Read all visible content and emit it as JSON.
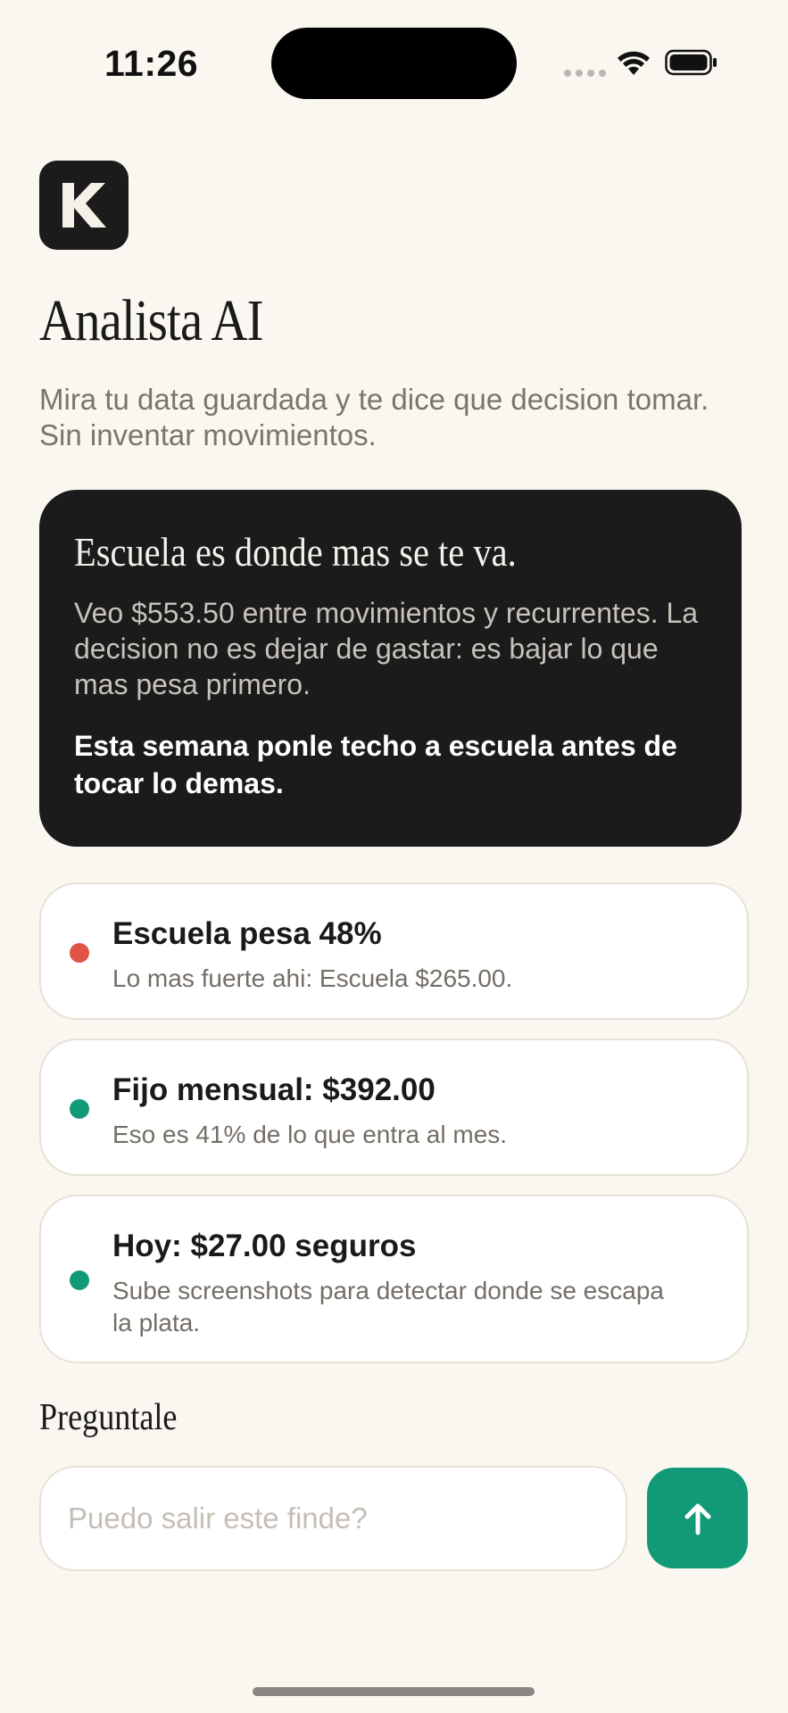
{
  "status_bar": {
    "time": "11:26"
  },
  "app": {
    "logo_letter": "K",
    "title": "Analista AI",
    "subtitle": "Mira tu data guardada y te dice que decision tomar. Sin inventar movimientos."
  },
  "insight": {
    "title": "Escuela es donde mas se te va.",
    "body": "Veo $553.50 entre movimientos y recurrentes. La decision no es dejar de gastar: es bajar lo que mas pesa primero.",
    "action": "Esta semana ponle techo a escuela antes de tocar lo demas."
  },
  "stats": [
    {
      "title": "Escuela pesa 48%",
      "subtitle": "Lo mas fuerte ahi: Escuela $265.00.",
      "dot_color": "#e05448"
    },
    {
      "title": "Fijo mensual: $392.00",
      "subtitle": "Eso es 41% de lo que entra al mes.",
      "dot_color": "#129a78"
    },
    {
      "title": "Hoy: $27.00 seguros",
      "subtitle": "Sube screenshots para detectar donde se escapa la plata.",
      "dot_color": "#129a78"
    }
  ],
  "ask": {
    "label": "Preguntale",
    "placeholder": "Puedo salir este finde?"
  },
  "colors": {
    "background": "#faf7f1",
    "dark_card": "#1b1b1b",
    "accent_green": "#129a78",
    "alert_red": "#e05448"
  },
  "icons": {
    "send": "arrow-up-icon",
    "wifi": "wifi-icon",
    "battery": "battery-icon",
    "signal": "signal-icon"
  }
}
